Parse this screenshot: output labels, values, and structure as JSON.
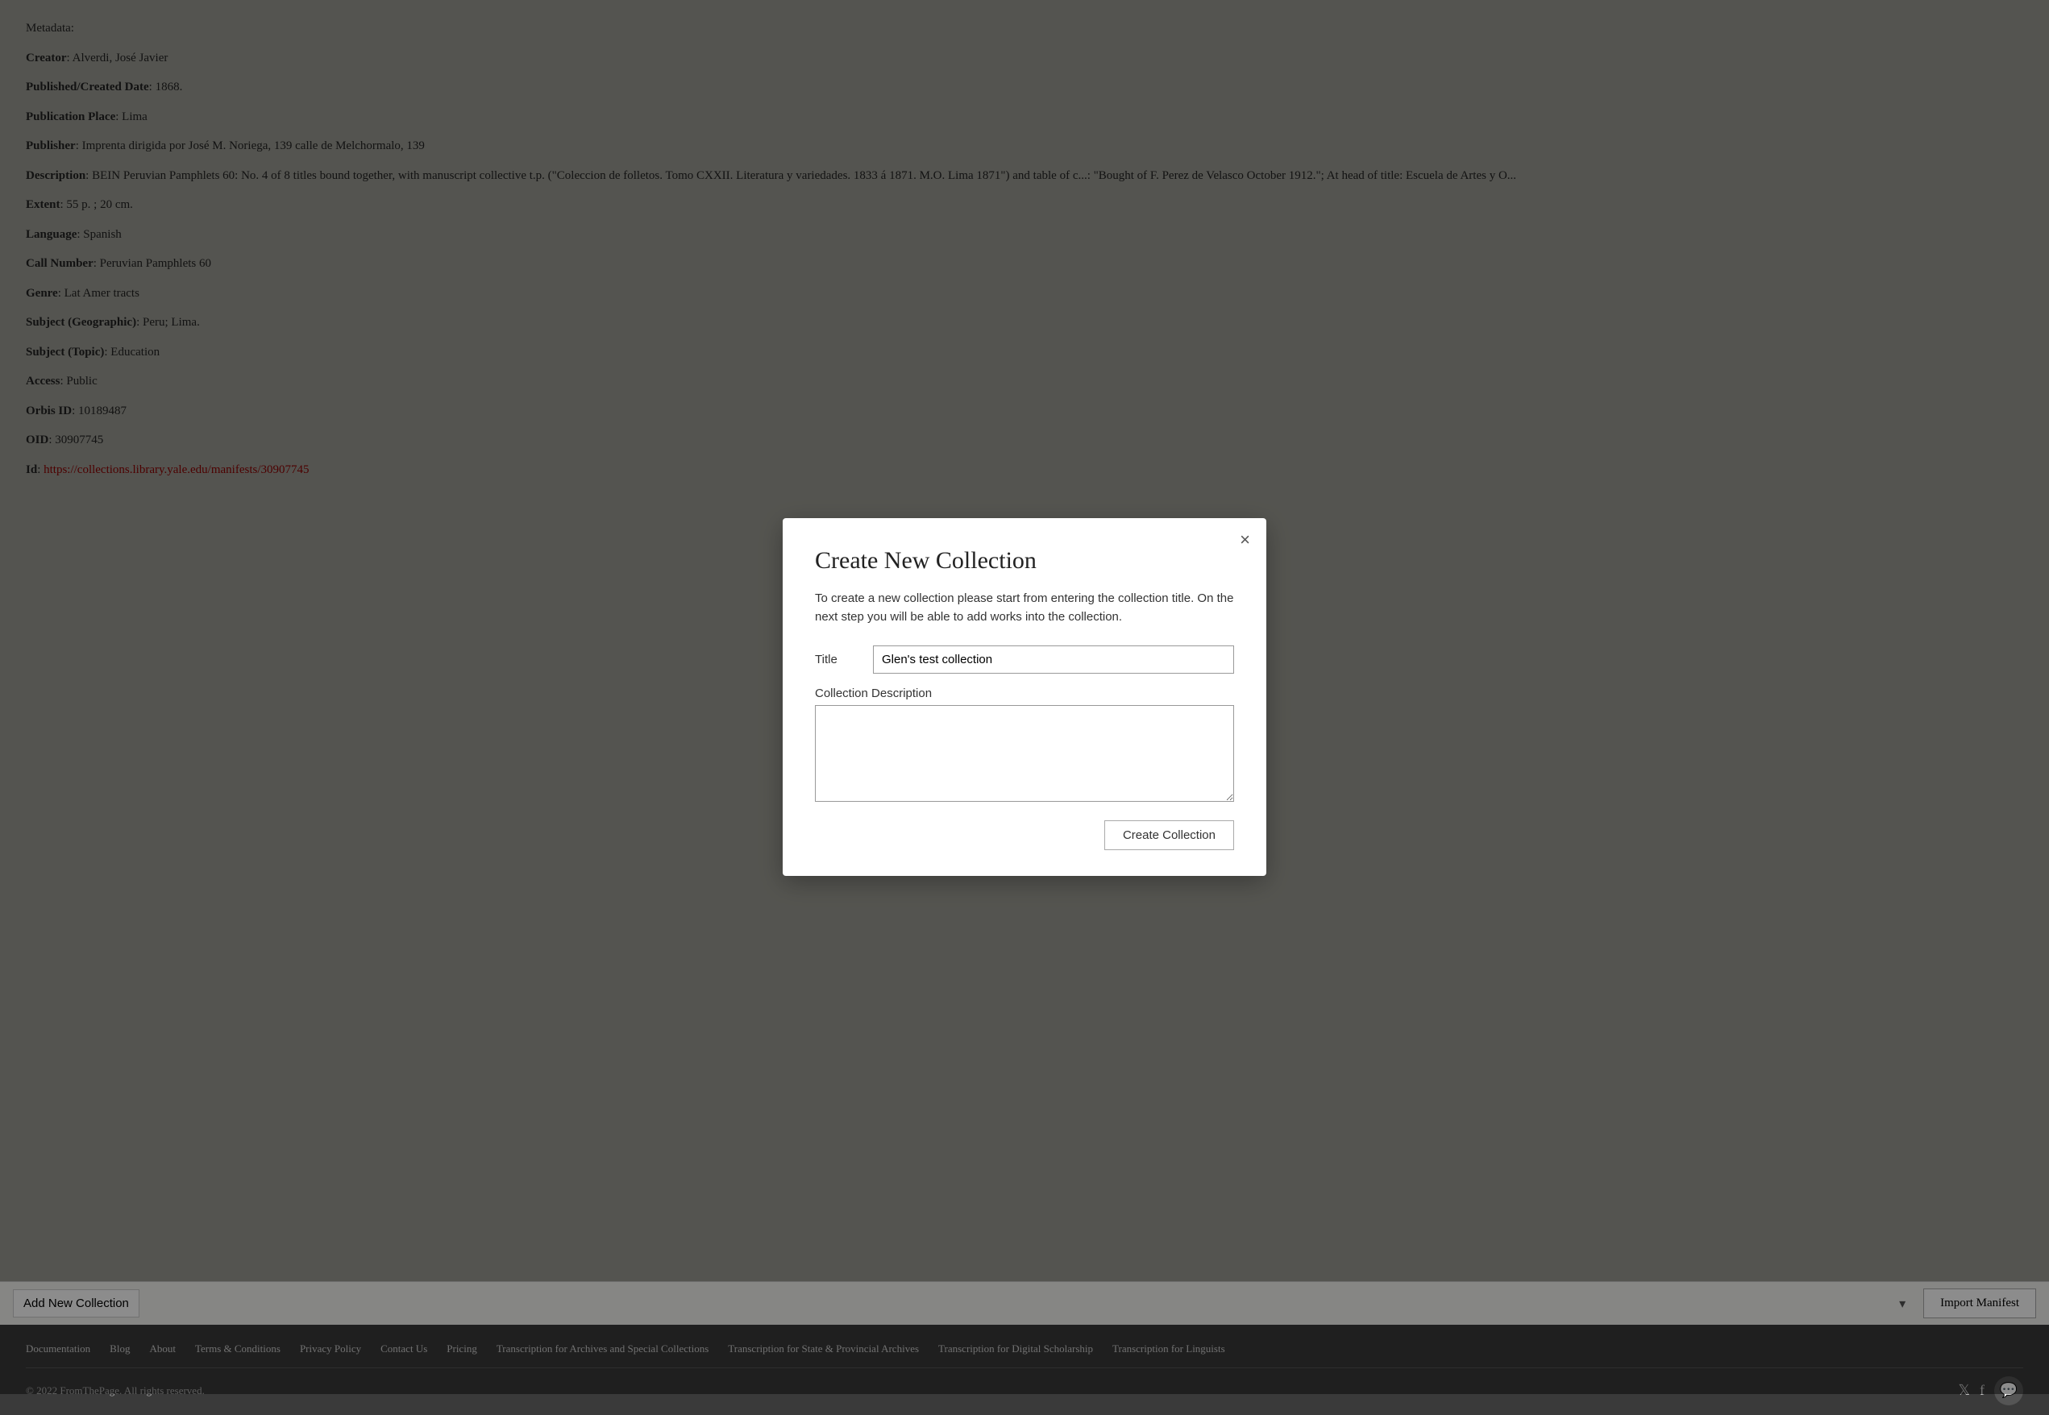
{
  "metadata": {
    "heading": "Metadata:",
    "fields": [
      {
        "label": "Creator",
        "value": "Alverdi, José Javier"
      },
      {
        "label": "Published/Created Date",
        "value": "1868."
      },
      {
        "label": "Publication Place",
        "value": "Lima"
      },
      {
        "label": "Publisher",
        "value": "Imprenta dirigida por José M. Noriega, 139 calle de Melchormalo, 139"
      },
      {
        "label": "Description",
        "value": "BEIN Peruvian Pamphlets 60: No. 4 of 8 titles bound together, with manuscript collective t.p. (\"Coleccion de folletos. Tomo CXXII. Literatura y variedades. 1833 á 1871. M.O. Lima 1871\") and table of c...: \"Bought of F. Perez de Velasco October 1912.\"; At head of title: Escuela de Artes y O..."
      },
      {
        "label": "Extent",
        "value": "55 p. ; 20 cm."
      },
      {
        "label": "Language",
        "value": "Spanish"
      },
      {
        "label": "Call Number",
        "value": "Peruvian Pamphlets 60"
      },
      {
        "label": "Genre",
        "value": "Lat Amer tracts"
      },
      {
        "label": "Subject (Geographic)",
        "value": "Peru; Lima."
      },
      {
        "label": "Subject (Topic)",
        "value": "Education"
      },
      {
        "label": "Access",
        "value": "Public"
      },
      {
        "label": "Orbis ID",
        "value": "10189487"
      },
      {
        "label": "OID",
        "value": "30907745"
      },
      {
        "label": "Id",
        "value": "https://collections.library.yale.edu/manifests/30907745",
        "link": true
      }
    ]
  },
  "add_collection": {
    "select_placeholder": "Add New Collection",
    "import_button": "Import Manifest"
  },
  "modal": {
    "title": "Create New Collection",
    "description": "To create a new collection please start from entering the collection title. On the next step you will be able to add works into the collection.",
    "title_label": "Title",
    "title_value": "Glen's test collection",
    "title_placeholder": "",
    "desc_label": "Collection Description",
    "desc_value": "",
    "create_button": "Create Collection",
    "close_label": "×"
  },
  "footer": {
    "links": [
      {
        "label": "Documentation",
        "href": "#"
      },
      {
        "label": "Blog",
        "href": "#"
      },
      {
        "label": "About",
        "href": "#"
      },
      {
        "label": "Terms & Conditions",
        "href": "#"
      },
      {
        "label": "Privacy Policy",
        "href": "#"
      },
      {
        "label": "Contact Us",
        "href": "#"
      },
      {
        "label": "Pricing",
        "href": "#"
      },
      {
        "label": "Transcription for Archives and Special Collections",
        "href": "#"
      },
      {
        "label": "Transcription for State & Provincial Archives",
        "href": "#"
      },
      {
        "label": "Transcription for Digital Scholarship",
        "href": "#"
      },
      {
        "label": "Transcription for Linguists",
        "href": "#"
      }
    ],
    "copyright": "© 2022 FromThePage. All rights reserved.",
    "from_the_page_link": "FromThePage"
  }
}
